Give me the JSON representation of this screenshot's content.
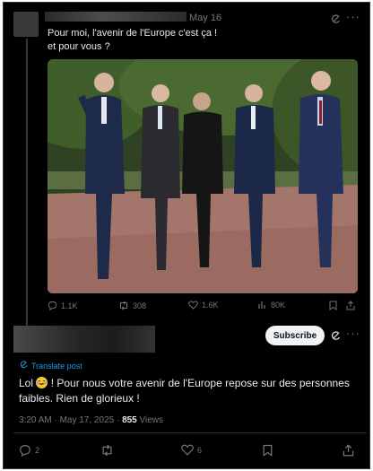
{
  "parent": {
    "date": "May 16",
    "text_line1": "Pour moi, l'avenir de l'Europe c'est ça !",
    "text_line2": "et pour vous ?",
    "actions": {
      "replies": "1.1K",
      "reposts": "308",
      "likes": "1.6K",
      "views": "80K"
    }
  },
  "reply": {
    "subscribe_label": "Subscribe",
    "translate_label": "Translate post",
    "text_before_emoji": "Lol",
    "text_after_emoji": "! Pour nous votre avenir de l'Europe repose sur des personnes faibles. Rien de glorieux !",
    "timestamp": "3:20 AM · May 17, 2025 ·",
    "views_count": "855",
    "views_label": "Views",
    "actions": {
      "replies": "2",
      "likes": "6"
    }
  },
  "colors": {
    "background": "#000000",
    "text": "#e7e9ea",
    "muted": "#71767b",
    "link": "#1d9bf0",
    "border": "#2f3336"
  }
}
